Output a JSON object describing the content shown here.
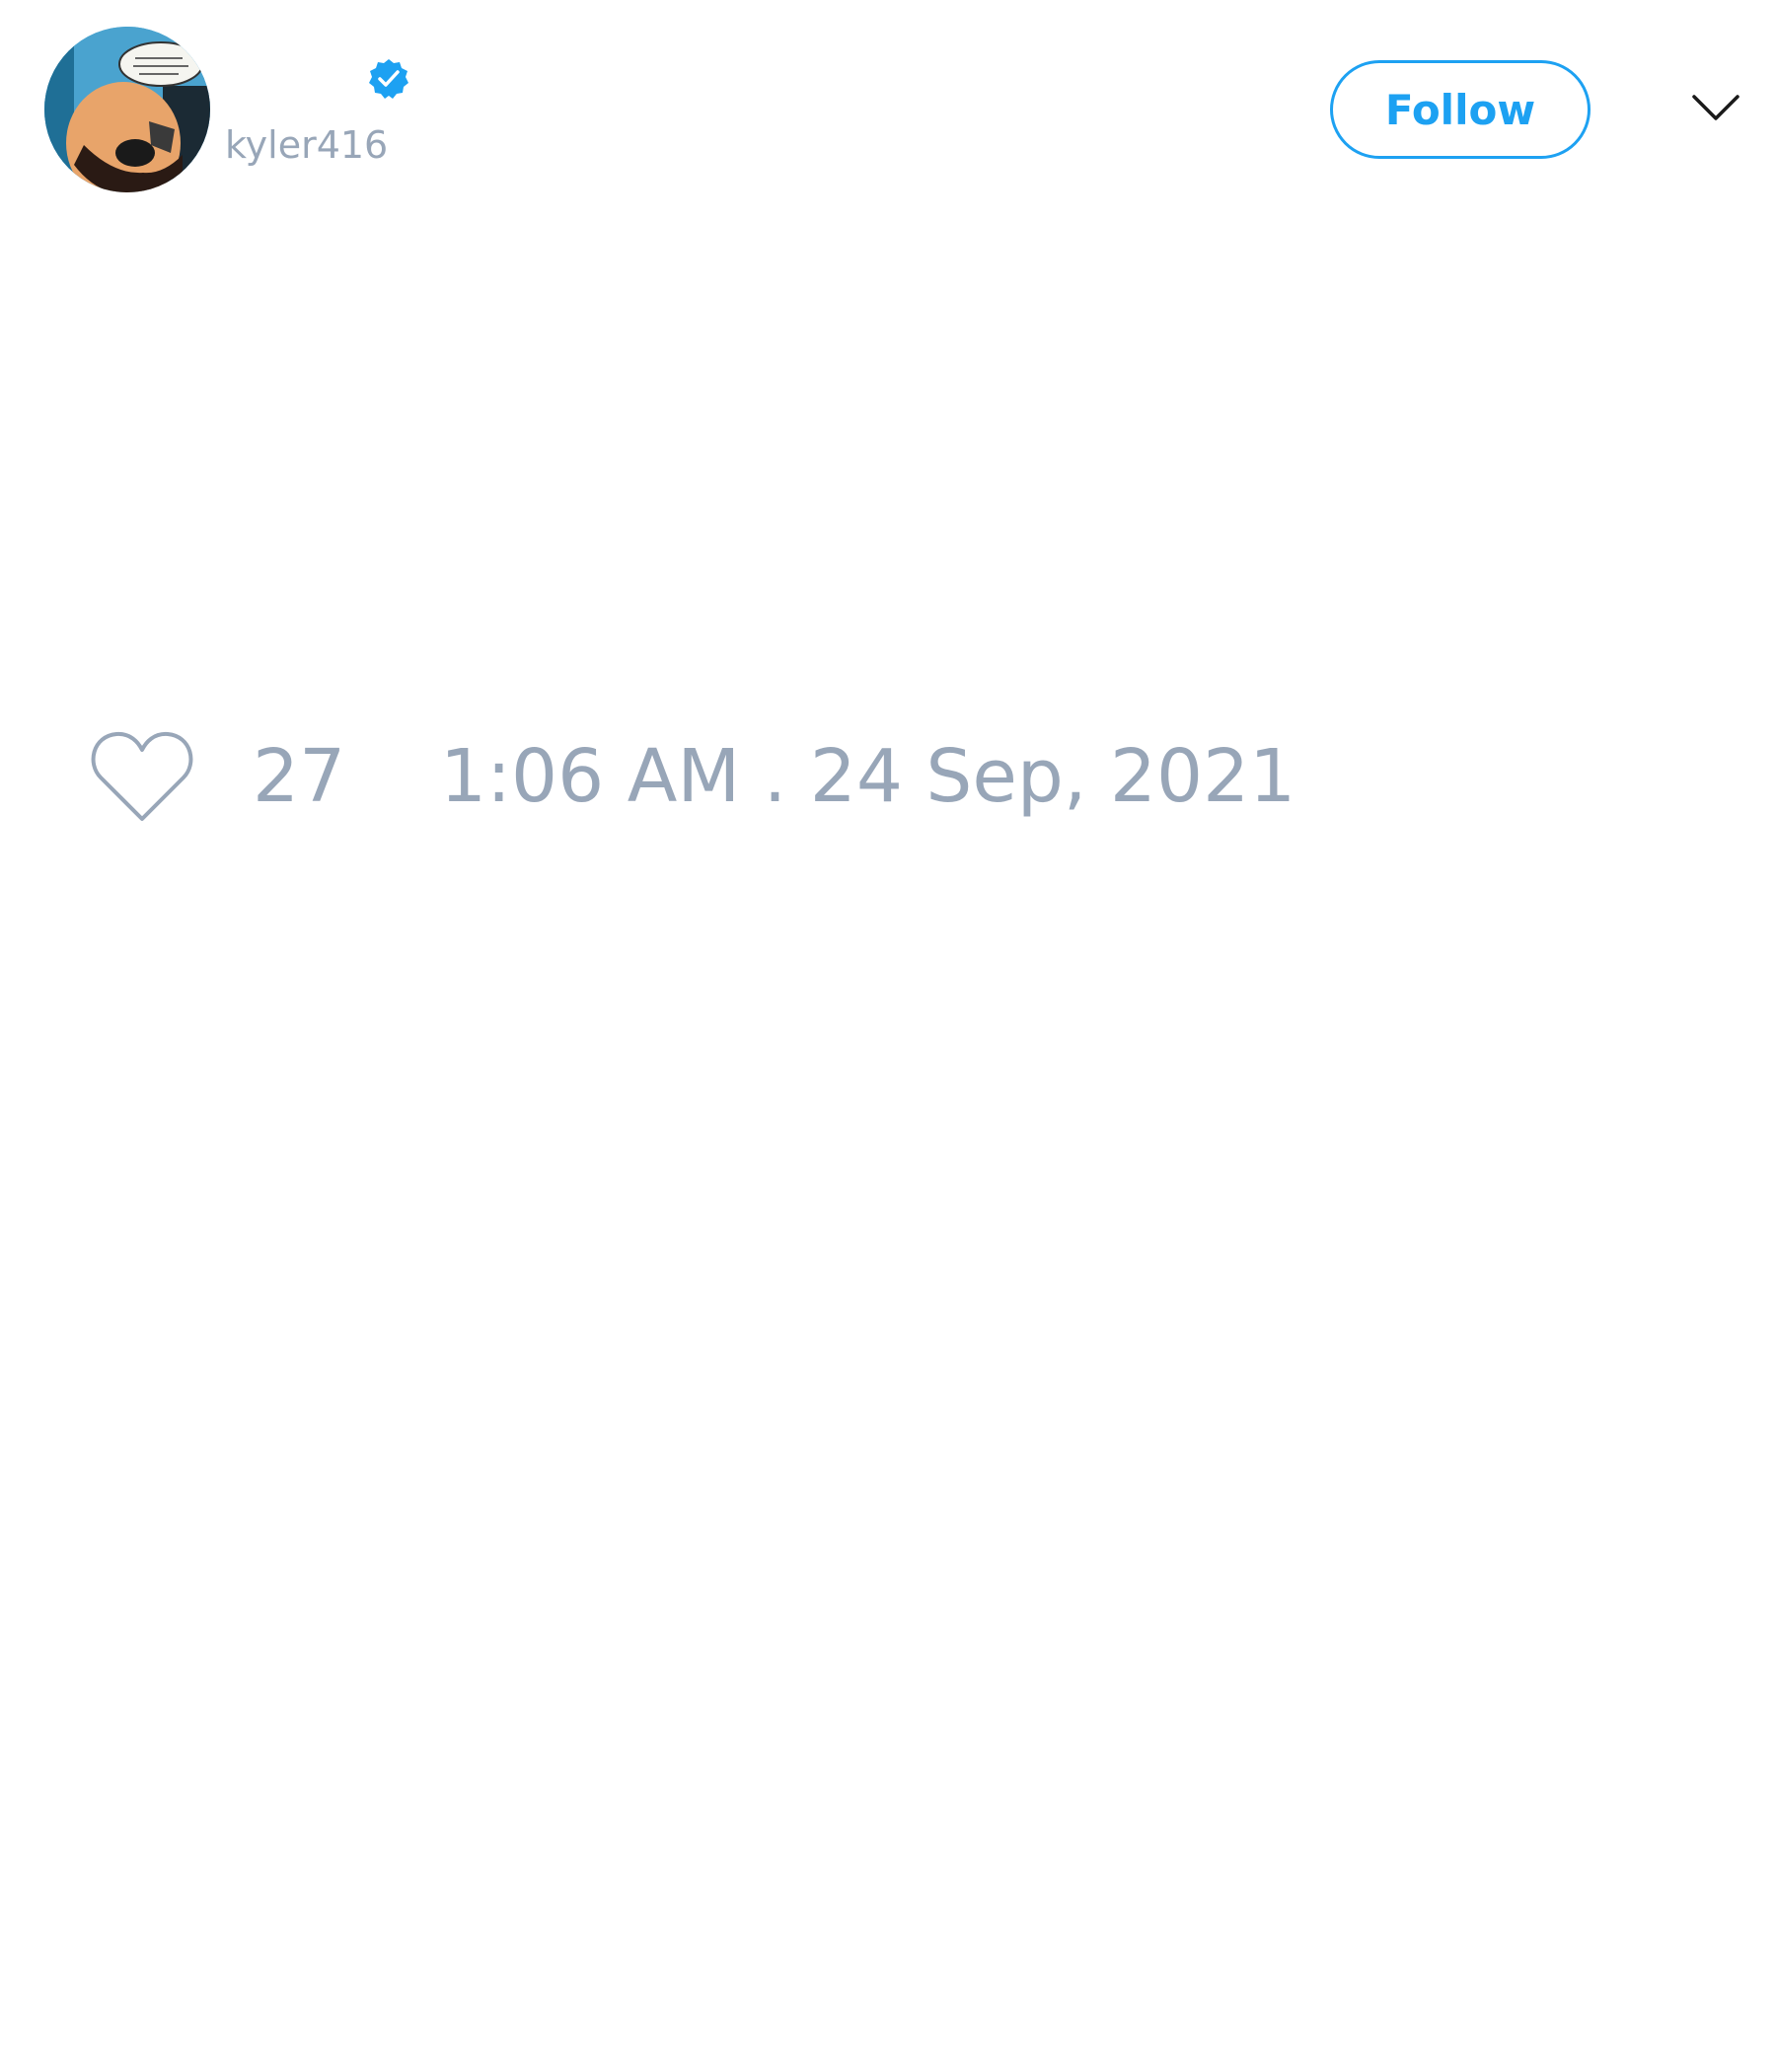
{
  "tweet": {
    "author": {
      "handle": "kyler416",
      "verified": true,
      "avatar_icon": "comic-character-avatar"
    },
    "follow_label": "Follow",
    "menu_icon": "chevron-down-icon",
    "likes": {
      "icon": "heart-outline-icon",
      "count": "27"
    },
    "timestamp": "1:06 AM . 24 Sep, 2021"
  },
  "colors": {
    "accent": "#1da1f2",
    "muted_text": "#98a6b8",
    "background": "#ffffff"
  }
}
